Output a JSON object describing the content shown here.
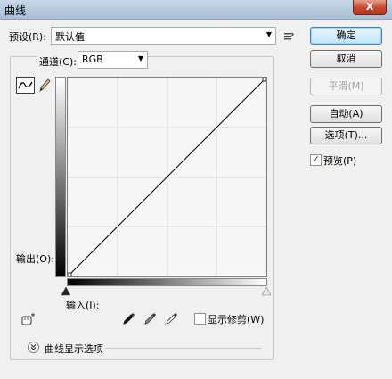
{
  "window": {
    "title": "曲线",
    "close_label": "X"
  },
  "preset": {
    "label": "预设(R):",
    "value": "默认值"
  },
  "channel": {
    "label": "通道(C):",
    "value": "RGB"
  },
  "buttons": {
    "ok": "确定",
    "cancel": "取消",
    "smooth": "平滑(M)",
    "auto": "自动(A)",
    "options": "选项(T)..."
  },
  "preview": {
    "label": "预览(P)",
    "checked": true
  },
  "graph": {
    "output_label": "输出(O):",
    "input_label": "输入(I):"
  },
  "show_clipping": {
    "label": "显示修剪(W)",
    "checked": false
  },
  "curve_display_options": {
    "label": "曲线显示选项"
  }
}
